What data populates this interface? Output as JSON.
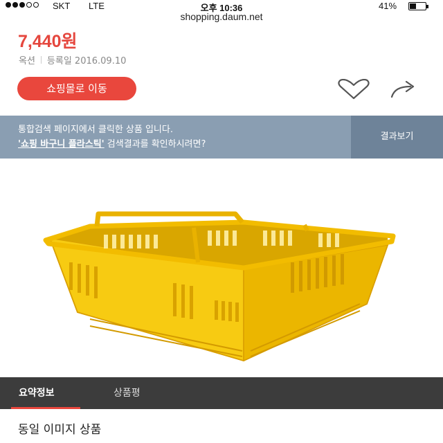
{
  "status_bar": {
    "carrier": "SKT",
    "network": "LTE",
    "time": "오후 10:36",
    "battery_percent": "41%",
    "battery_level": 0.41,
    "signal_bars_filled": 3,
    "signal_bars_total": 5
  },
  "browser": {
    "url": "shopping.daum.net"
  },
  "product": {
    "price": "7,440원",
    "seller": "옥션",
    "registered": "등록일 2016.09.10",
    "goto_shop_label": "쇼핑몰로 이동",
    "image_icon": "yellow-shopping-basket",
    "image_color": "#f5c400"
  },
  "actions": {
    "like_icon": "heart-outline-icon",
    "share_icon": "share-arrow-icon"
  },
  "notice": {
    "line1": "통합검색 페이지에서 클릭한 상품 입니다.",
    "link": "'쇼핑 바구니 플라스틱'",
    "line2_suffix": " 검색결과를 확인하시려면?",
    "button_label": "결과보기"
  },
  "tabs": [
    {
      "label": "요약정보",
      "active": true
    },
    {
      "label": "상품평",
      "active": false
    }
  ],
  "section": {
    "title": "동일 이미지 상품"
  },
  "colors": {
    "accent": "#e9473d",
    "notice_bg": "#8a9eb2",
    "notice_button_bg": "#6e8399",
    "tab_bar_bg": "#3c3c3c"
  }
}
